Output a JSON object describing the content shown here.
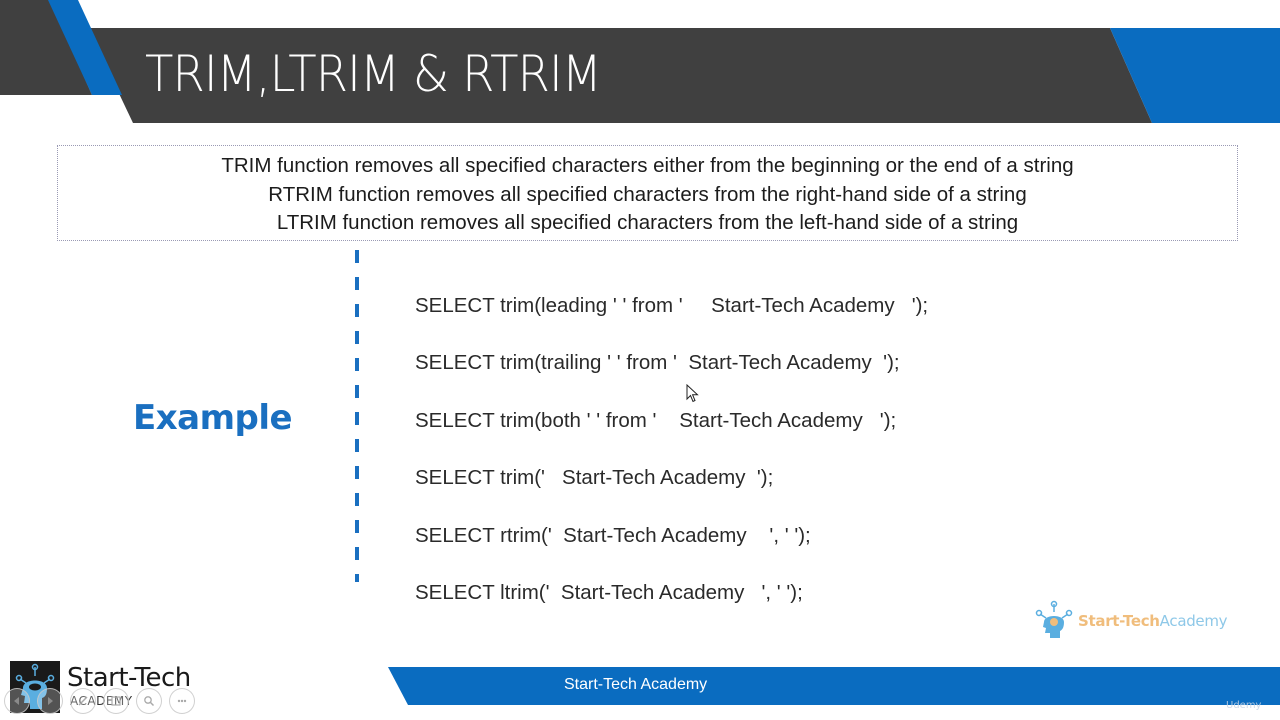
{
  "slide": {
    "title": "TRIM,LTRIM & RTRIM",
    "colors": {
      "header_dark": "#404040",
      "accent_blue": "#0a6cc0",
      "example_blue": "#1a6fc0",
      "text": "#1c1c1c"
    },
    "definitions": [
      "TRIM function removes all specified characters either from the beginning or the end of a string",
      "RTRIM function removes all specified characters from the right-hand side of a string",
      "LTRIM function removes all specified characters from the left-hand side of a string"
    ],
    "example_label": "Example",
    "code_examples": [
      "SELECT trim(leading ' ' from '     Start-Tech Academy   ');",
      "SELECT trim(trailing ' ' from '  Start-Tech Academy  ');",
      "SELECT trim(both ' ' from '    Start-Tech Academy   ');",
      "SELECT trim('   Start-Tech Academy  ');",
      "SELECT rtrim('  Start-Tech Academy    ', ' ');",
      "SELECT ltrim('  Start-Tech Academy   ', ' ');"
    ],
    "brand_right": {
      "part1": "Start-Tech",
      "part2": "Academy"
    },
    "footer_text": "Start-Tech Academy",
    "watermark": "Udemy"
  },
  "logo_left": {
    "line1": "Start-Tech",
    "line2": "ACADEMY"
  },
  "player_controls": [
    {
      "name": "previous-slide-button",
      "icon": "triangle-left-icon"
    },
    {
      "name": "next-slide-button",
      "icon": "triangle-right-icon"
    },
    {
      "name": "pen-tool-button",
      "icon": "pencil-icon"
    },
    {
      "name": "slide-view-button",
      "icon": "screen-icon"
    },
    {
      "name": "zoom-button",
      "icon": "magnifier-icon"
    },
    {
      "name": "more-options-button",
      "icon": "ellipsis-icon"
    }
  ]
}
